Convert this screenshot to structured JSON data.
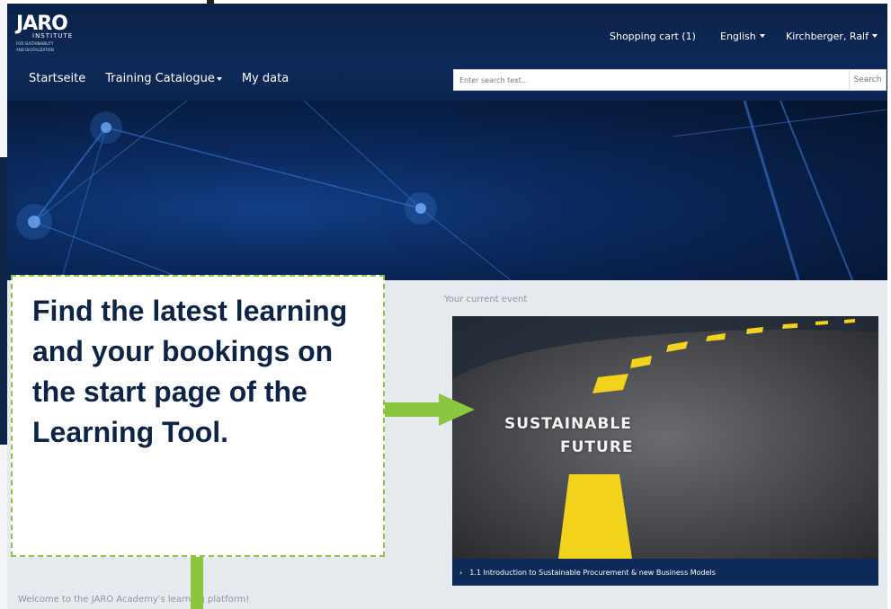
{
  "logo": {
    "mark": "JARO",
    "institute": "INSTITUTE",
    "sub_line1": "FOR SUSTAINABILITY",
    "sub_line2": "AND DIGITALIZATION"
  },
  "utility_nav": {
    "cart": "Shopping cart (1)",
    "language": "English",
    "user": "Kirchberger, Ralf"
  },
  "main_menu": {
    "home": "Startseite",
    "catalogue": "Training Catalogue",
    "my_data": "My data"
  },
  "search": {
    "placeholder": "Enter search text...",
    "button": "Search"
  },
  "content": {
    "current_event_label": "Your current event",
    "event_image_text_line1": "SUSTAINABLE",
    "event_image_text_line2": "FUTURE",
    "event_title": "1.1 Introduction to Sustainable Procurement & new Business Models",
    "welcome": "Welcome to the JARO Academy's learning platform!"
  },
  "annotation": {
    "text": "Find the latest learning and your bookings on the start page of the Learning Tool."
  },
  "colors": {
    "navy": "#0e2a58",
    "annotation_green": "#8cc63f",
    "page_bg": "#e6e9ee"
  }
}
